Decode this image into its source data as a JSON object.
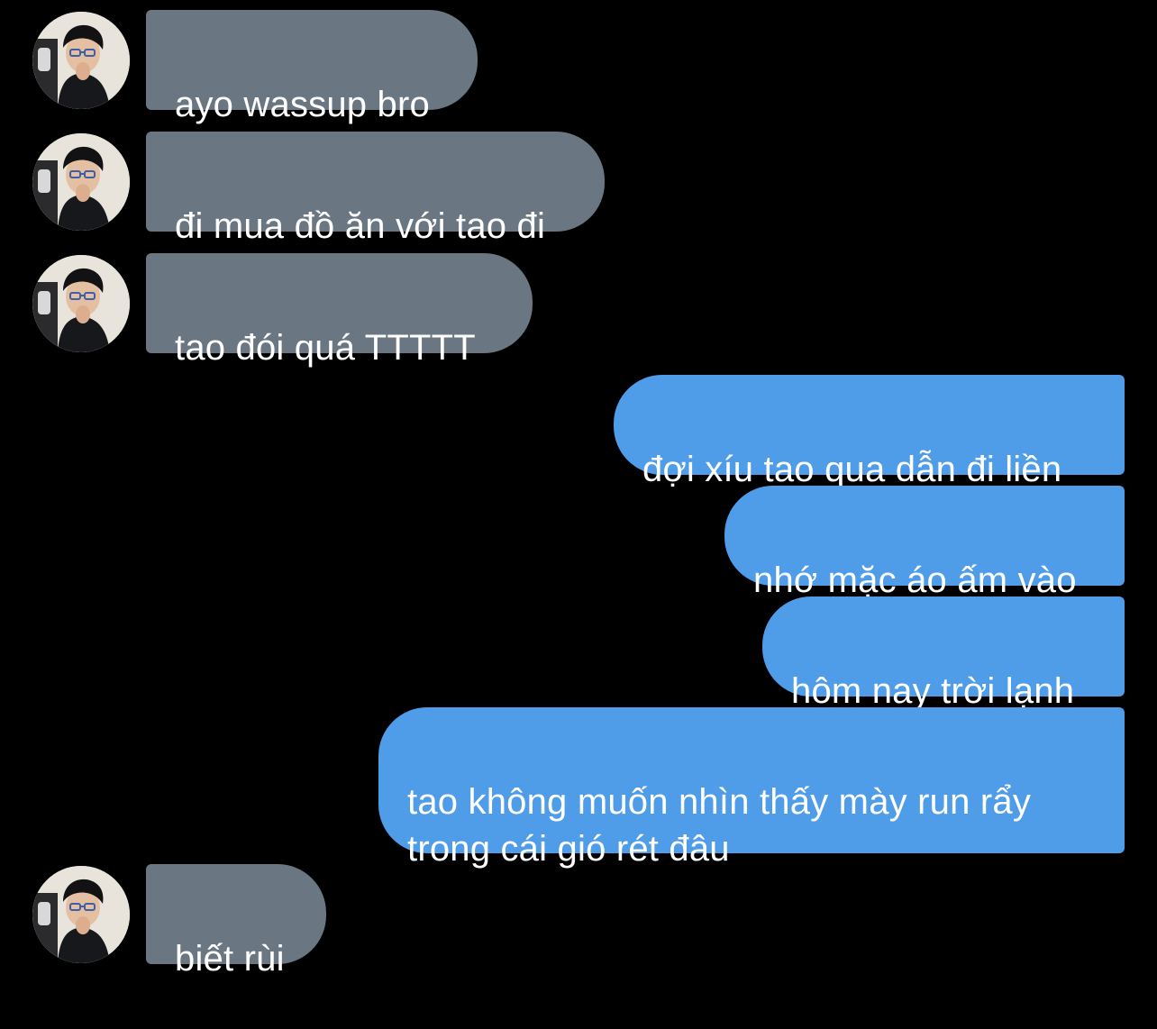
{
  "theme": {
    "background": "#000000",
    "incoming_bubble": "#6b7683",
    "outgoing_bubble": "#4f9ce8",
    "text_color": "#ffffff"
  },
  "contact": {
    "avatar_icon": "profile-photo-icon"
  },
  "messages": [
    {
      "direction": "incoming",
      "text": "ayo wassup bro"
    },
    {
      "direction": "incoming",
      "text": "đi mua đồ ăn với tao đi"
    },
    {
      "direction": "incoming",
      "text": "tao đói quá TTTTT"
    },
    {
      "direction": "outgoing",
      "text": "đợi xíu tao qua dẫn đi liền"
    },
    {
      "direction": "outgoing",
      "text": "nhớ mặc áo ấm vào"
    },
    {
      "direction": "outgoing",
      "text": "hôm nay trời lạnh"
    },
    {
      "direction": "outgoing",
      "text": "tao không muốn nhìn thấy mày run rẩy\ntrong cái gió rét đâu"
    },
    {
      "direction": "incoming",
      "text": "biết rùi"
    }
  ]
}
